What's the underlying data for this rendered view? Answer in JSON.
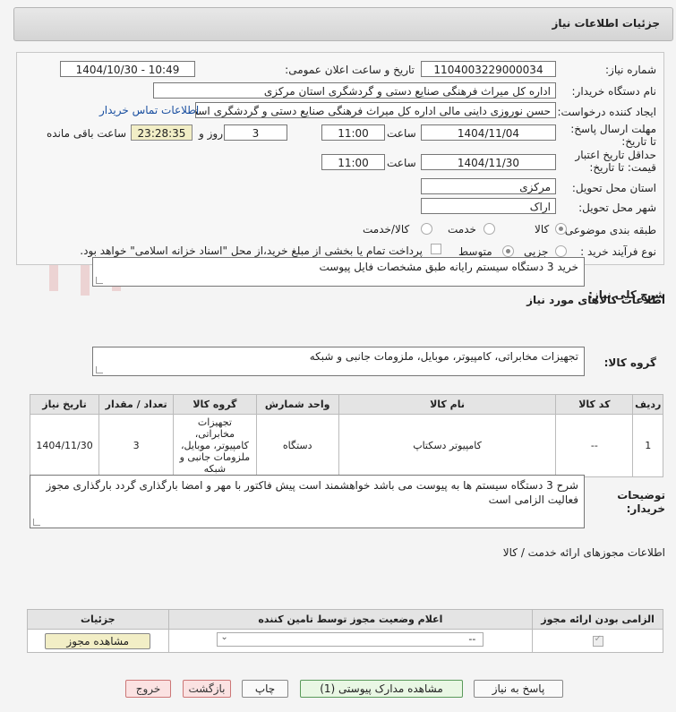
{
  "page_title": "جزئیات اطلاعات نیاز",
  "watermark": "AriaTender.neT",
  "fields": {
    "need_number_label": "شماره نیاز:",
    "need_number": "1104003229000034",
    "announce_label": "تاریخ و ساعت اعلان عمومی:",
    "announce_value": "1404/10/30 - 10:49",
    "buyer_label": "نام دستگاه خریدار:",
    "buyer_value": "اداره کل میراث فرهنگی  صنایع دستی و گردشگری استان مرکزی",
    "creator_label": "ایجاد کننده درخواست:",
    "creator_value": "حسن نوروزی داینی مالی  اداره کل میراث فرهنگی  صنایع دستی و گردشگری استان مرکزی",
    "contact_link": "اطلاعات تماس خریدار",
    "deadline_label": "مهلت ارسال پاسخ: تا تاریخ:",
    "deadline_date": "1404/11/04",
    "time_label": "ساعت",
    "deadline_time": "11:00",
    "days_value": "3",
    "days_label": "روز و",
    "remain_value": "23:28:35",
    "remain_label": "ساعت باقی مانده",
    "validity_label": "حداقل تاریخ اعتبار قیمت: تا تاریخ:",
    "validity_date": "1404/11/30",
    "validity_time": "11:00",
    "province_label": "استان محل تحویل:",
    "province_value": "مرکزی",
    "city_label": "شهر محل تحویل:",
    "city_value": "اراک",
    "category_label": "طبقه بندی موضوعی:",
    "category_options": [
      "کالا",
      "خدمت",
      "کالا/خدمت"
    ],
    "process_label": "نوع فرآیند خرید :",
    "process_options": [
      "جزیی",
      "متوسط"
    ],
    "process_note": "پرداخت تمام یا بخشی از مبلغ خرید،از محل \"اسناد خزانه اسلامی\" خواهد بود."
  },
  "summary": {
    "label": "شرح کلی نیاز:",
    "value": "خرید 3 دستگاه سیستم رایانه طبق مشخصات فایل پیوست"
  },
  "goods_info_title": "اطلاعات کالاهای مورد نیاز",
  "goods_group": {
    "label": "گروه کالا:",
    "value": "تجهیزات مخابراتی، کامپیوتر، موبایل، ملزومات جانبی و شبکه"
  },
  "goods_table": {
    "headers": [
      "ردیف",
      "کد کالا",
      "نام کالا",
      "واحد شمارش",
      "گروه کالا",
      "تعداد / مقدار",
      "تاریخ نیاز"
    ],
    "rows": [
      [
        "1",
        "--",
        "کامپیوتر دسکتاپ",
        "دستگاه",
        "تجهیزات مخابراتی، کامپیوتر، موبایل، ملزومات جانبی و شبکه",
        "3",
        "1404/11/30"
      ]
    ]
  },
  "buyer_notes": {
    "label": "توضیحات خریدار:",
    "value": "شرح  3 دستگاه سیستم ها به پیوست می باشد خواهشمند است پیش فاکتور با مهر  و امضا بارگذاری گردد بارگذاری مجوز فعالیت الزامی است"
  },
  "permits_title": "اطلاعات مجوزهای ارائه خدمت / کالا",
  "permits_table": {
    "headers": [
      "الزامی بودن ارائه مجوز",
      "اعلام وضعیت مجوز توسط تامین کننده",
      "جزئیات"
    ],
    "select_value": "--",
    "view_button": "مشاهده مجوز"
  },
  "buttons": {
    "reply": "پاسخ به نیاز",
    "attachments": "مشاهده مدارک پیوستی (1)",
    "print": "چاپ",
    "back": "بازگشت",
    "exit": "خروج"
  }
}
